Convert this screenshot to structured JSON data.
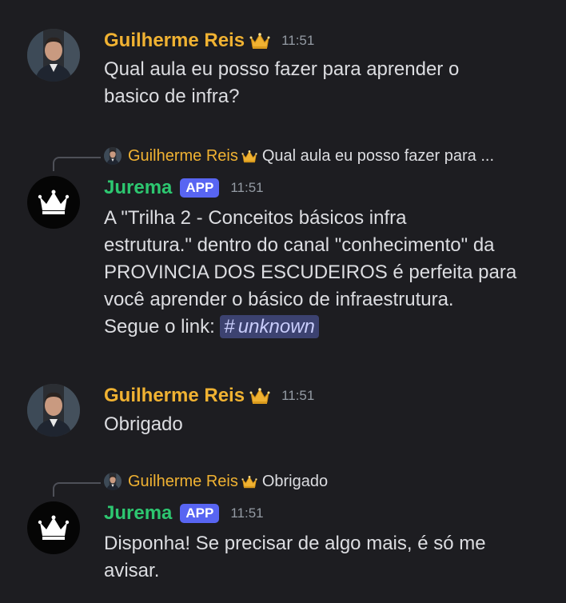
{
  "messages": [
    {
      "author": "Guilherme Reis",
      "time": "11:51",
      "text_lines": [
        "Qual aula eu posso fazer para aprender o",
        "basico de infra?"
      ]
    },
    {
      "reply": {
        "author": "Guilherme Reis",
        "text": "Qual aula eu posso fazer para ..."
      },
      "author": "Jurema",
      "badge": "APP",
      "time": "11:51",
      "text_lines": [
        "A \"Trilha 2 - Conceitos básicos infra",
        "estrutura.\" dentro do canal \"conhecimento\" da",
        "PROVINCIA DOS ESCUDEIROS é perfeita para",
        "você aprender o básico de infraestrutura."
      ],
      "link_prefix": "Segue o link: ",
      "channel_hash": "#",
      "channel_name": "unknown"
    },
    {
      "author": "Guilherme Reis",
      "time": "11:51",
      "text_lines": [
        "Obrigado"
      ]
    },
    {
      "reply": {
        "author": "Guilherme Reis",
        "text": "Obrigado"
      },
      "author": "Jurema",
      "badge": "APP",
      "time": "11:51",
      "text_lines": [
        "Disponha! Se precisar de algo mais, é só me",
        "avisar."
      ]
    }
  ],
  "icons": {
    "crown": "crown-icon",
    "bot_avatar": "crown-bot-avatar",
    "user_avatar": "user-photo-avatar"
  },
  "colors": {
    "background": "#1d1d21",
    "user_name": "#f0b232",
    "bot_name": "#2dc770",
    "app_badge": "#5865f2",
    "mention_bg": "#3c4270"
  }
}
